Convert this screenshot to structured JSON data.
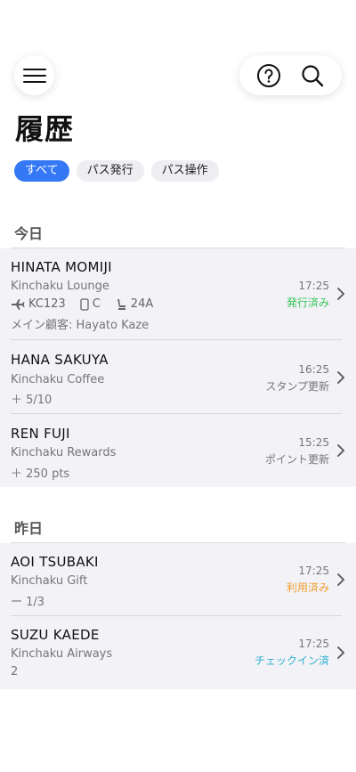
{
  "header": {
    "title": "履歴"
  },
  "filters": [
    {
      "label": "すべて",
      "active": true
    },
    {
      "label": "パス発行",
      "active": false
    },
    {
      "label": "パス操作",
      "active": false
    }
  ],
  "sections": [
    {
      "title": "今日",
      "items": [
        {
          "name": "HINATA MOMIJI",
          "place": "Kinchaku Lounge",
          "flight": "KC123",
          "class": "C",
          "seat": "24A",
          "extra": "メイン顧客: Hayato Kaze",
          "time": "17:25",
          "status": "発行済み",
          "status_color": "#34c759"
        },
        {
          "name": "HANA SAKUYA",
          "place": "Kinchaku Coffee",
          "extra": "＋ 5/10",
          "time": "16:25",
          "status": "スタンプ更新",
          "status_color": "#777777"
        },
        {
          "name": "REN FUJI",
          "place": "Kinchaku Rewards",
          "extra": "＋ 250 pts",
          "time": "15:25",
          "status": "ポイント更新",
          "status_color": "#777777"
        }
      ]
    },
    {
      "title": "昨日",
      "items": [
        {
          "name": "AOI TSUBAKI",
          "place": "Kinchaku Gift",
          "extra": "ー 1/3",
          "time": "17:25",
          "status": "利用済み",
          "status_color": "#f0a030"
        },
        {
          "name": "SUZU KAEDE",
          "place": "Kinchaku Airways",
          "extra": "2",
          "time": "17:25",
          "status": "チェックイン済",
          "status_color": "#30b0d0"
        }
      ]
    }
  ],
  "icons": {
    "menu": "menu-icon",
    "help": "help-icon",
    "search": "search-icon",
    "plane": "plane-icon",
    "class": "class-icon",
    "seat": "seat-icon",
    "chevron": "chevron-right-icon"
  }
}
